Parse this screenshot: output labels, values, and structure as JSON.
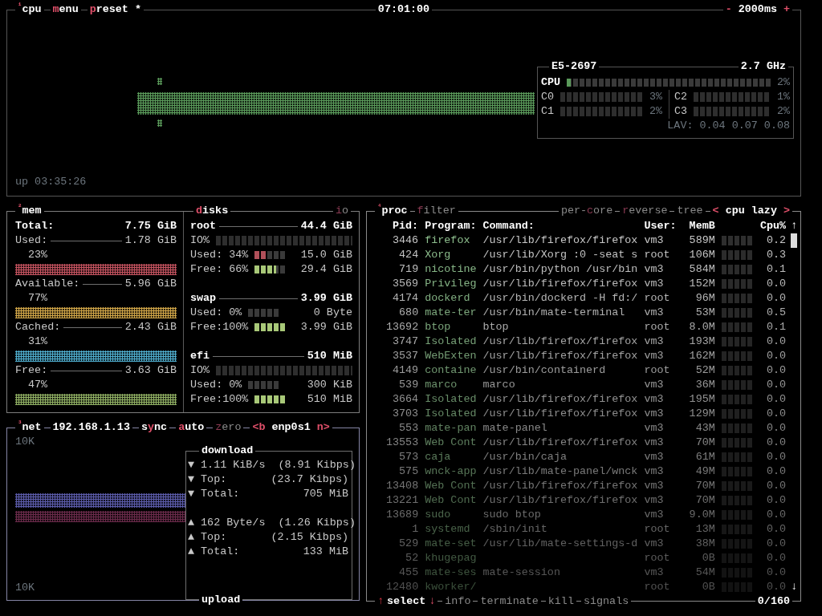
{
  "cpu": {
    "header": [
      {
        "index": "¹",
        "label": "cpu",
        "active": true
      },
      {
        "label": "**m**enu",
        "active": true
      },
      {
        "label": "**p**reset *",
        "active": true
      }
    ],
    "clock": "07:01:00",
    "interval": {
      "minus": "-",
      "value": "2000ms",
      "plus": "+"
    },
    "uptime": "up 03:35:26",
    "info": {
      "model": "E5-2697",
      "frequency": "2.7 GHz",
      "total": {
        "label": "CPU",
        "level": 0.02,
        "value": "2%"
      },
      "cores": [
        {
          "label": "C0",
          "value": "3%"
        },
        {
          "label": "C1",
          "value": "2%"
        },
        {
          "label": "C2",
          "value": "1%"
        },
        {
          "label": "C3",
          "value": "2%"
        }
      ],
      "load": "LAV: 0.04 0.07 0.08"
    }
  },
  "mem": {
    "header": {
      "index": "²",
      "label": "mem",
      "active": true
    },
    "total": {
      "label": "Total:",
      "value": "7.75 GiB"
    },
    "items": [
      {
        "label": "Used:",
        "value": "1.78 GiB",
        "percent": "23%",
        "color": "#c2525e"
      },
      {
        "label": "Available:",
        "value": "5.96 GiB",
        "percent": "77%",
        "color": "#cfa447"
      },
      {
        "label": "Cached:",
        "value": "2.43 GiB",
        "percent": "31%",
        "color": "#4eaccc"
      },
      {
        "label": "Free:",
        "value": "3.63 GiB",
        "percent": "47%",
        "color": "#8fae62"
      }
    ]
  },
  "disks": {
    "header": {
      "label": "**d**isks",
      "active": true
    },
    "io_toggle": {
      "label": "**i**o",
      "active": false
    },
    "items": [
      {
        "name": "root",
        "size": "44.4 GiB",
        "io_label": "IO%",
        "used": {
          "label": "Used: 34%",
          "level": 0.34,
          "value": "15.0 GiB"
        },
        "free": {
          "label": "Free: 66%",
          "level": 0.66,
          "value": "29.4 GiB"
        }
      },
      {
        "name": "swap",
        "size": "3.99 GiB",
        "used": {
          "label": "Used:  0%",
          "value": "0 Byte"
        },
        "free": {
          "label": "Free:100%",
          "level": 1,
          "value": "3.99 GiB"
        }
      },
      {
        "name": "efi",
        "size": "510 MiB",
        "io_label": "IO%",
        "used": {
          "label": "Used:  0%",
          "value": "300 KiB"
        },
        "free": {
          "label": "Free:100%",
          "level": 1,
          "value": "510 MiB"
        }
      }
    ]
  },
  "net": {
    "header": [
      {
        "index": "³",
        "label": "net",
        "active": true
      },
      {
        "label": "192.168.1.13",
        "active": true
      },
      {
        "label": "s**y**nc",
        "active": true
      },
      {
        "label": "**a**uto",
        "active": true
      },
      {
        "label": "**z**ero",
        "active": false
      }
    ],
    "interface": {
      "prev": "<b",
      "name": "enp0s1",
      "next": "n>"
    },
    "scale_top": "10K",
    "scale_bottom": "10K",
    "download": {
      "title": "download",
      "arrow": "▼",
      "lines": [
        {
          "label": "1.11 KiB/s",
          "value": "(8.91 Kibps)"
        },
        {
          "label": "Top:",
          "value": "(23.7 Kibps)"
        },
        {
          "label": "Total:",
          "value": "705 MiB"
        }
      ]
    },
    "upload": {
      "title": "upload",
      "arrow": "▲",
      "lines": [
        {
          "label": "162 Byte/s",
          "value": "(1.26 Kibps)"
        },
        {
          "label": "Top:",
          "value": "(2.15 Kibps)"
        },
        {
          "label": "Total:",
          "value": "133 MiB"
        }
      ]
    }
  },
  "proc": {
    "header": [
      {
        "index": "⁴",
        "label": "proc",
        "active": true
      },
      {
        "label": "**f**ilter",
        "active": false
      }
    ],
    "options": [
      {
        "label": "per-**c**ore",
        "active": false
      },
      {
        "label": "**r**everse",
        "active": false
      },
      {
        "label": "tree",
        "active": false
      }
    ],
    "sort": {
      "prev": "<",
      "value": "cpu lazy",
      "next": ">"
    },
    "columns": [
      "Pid:",
      "Program:",
      "Command:",
      "User:",
      "MemB",
      "Cpu%"
    ],
    "rows": [
      {
        "pid": "3446",
        "program": "firefox",
        "command": "/usr/lib/firefox/firefox",
        "user": "vm3",
        "mem": "589M",
        "cpu": "0.2"
      },
      {
        "pid": "424",
        "program": "Xorg",
        "command": "/usr/lib/Xorg :0 -seat s",
        "user": "root",
        "mem": "106M",
        "cpu": "0.3"
      },
      {
        "pid": "719",
        "program": "nicotine",
        "command": "/usr/bin/python /usr/bin",
        "user": "vm3",
        "mem": "584M",
        "cpu": "0.1"
      },
      {
        "pid": "3569",
        "program": "Privileg",
        "command": "/usr/lib/firefox/firefox",
        "user": "vm3",
        "mem": "152M",
        "cpu": "0.0"
      },
      {
        "pid": "4174",
        "program": "dockerd",
        "command": "/usr/bin/dockerd -H fd:/",
        "user": "root",
        "mem": "96M",
        "cpu": "0.0"
      },
      {
        "pid": "680",
        "program": "mate-ter",
        "command": "/usr/bin/mate-terminal",
        "user": "vm3",
        "mem": "53M",
        "cpu": "0.5"
      },
      {
        "pid": "13692",
        "program": "btop",
        "command": "btop",
        "user": "root",
        "mem": "8.0M",
        "cpu": "0.1"
      },
      {
        "pid": "3747",
        "program": "Isolated",
        "command": "/usr/lib/firefox/firefox",
        "user": "vm3",
        "mem": "193M",
        "cpu": "0.0"
      },
      {
        "pid": "3537",
        "program": "WebExten",
        "command": "/usr/lib/firefox/firefox",
        "user": "vm3",
        "mem": "162M",
        "cpu": "0.0"
      },
      {
        "pid": "4149",
        "program": "containe",
        "command": "/usr/bin/containerd",
        "user": "root",
        "mem": "52M",
        "cpu": "0.0"
      },
      {
        "pid": "539",
        "program": "marco",
        "command": "marco",
        "user": "vm3",
        "mem": "36M",
        "cpu": "0.0"
      },
      {
        "pid": "3664",
        "program": "Isolated",
        "command": "/usr/lib/firefox/firefox",
        "user": "vm3",
        "mem": "195M",
        "cpu": "0.0"
      },
      {
        "pid": "3703",
        "program": "Isolated",
        "command": "/usr/lib/firefox/firefox",
        "user": "vm3",
        "mem": "129M",
        "cpu": "0.0"
      },
      {
        "pid": "553",
        "program": "mate-pan",
        "command": "mate-panel",
        "user": "vm3",
        "mem": "43M",
        "cpu": "0.0"
      },
      {
        "pid": "13553",
        "program": "Web Cont",
        "command": "/usr/lib/firefox/firefox",
        "user": "vm3",
        "mem": "70M",
        "cpu": "0.0"
      },
      {
        "pid": "573",
        "program": "caja",
        "command": "/usr/bin/caja",
        "user": "vm3",
        "mem": "61M",
        "cpu": "0.0"
      },
      {
        "pid": "575",
        "program": "wnck-app",
        "command": "/usr/lib/mate-panel/wnck",
        "user": "vm3",
        "mem": "49M",
        "cpu": "0.0"
      },
      {
        "pid": "13408",
        "program": "Web Cont",
        "command": "/usr/lib/firefox/firefox",
        "user": "vm3",
        "mem": "70M",
        "cpu": "0.0"
      },
      {
        "pid": "13221",
        "program": "Web Cont",
        "command": "/usr/lib/firefox/firefox",
        "user": "vm3",
        "mem": "70M",
        "cpu": "0.0"
      },
      {
        "pid": "13689",
        "program": "sudo",
        "command": "sudo btop",
        "user": "vm3",
        "mem": "9.0M",
        "cpu": "0.0"
      },
      {
        "pid": "1",
        "program": "systemd",
        "command": "/sbin/init",
        "user": "root",
        "mem": "13M",
        "cpu": "0.0"
      },
      {
        "pid": "529",
        "program": "mate-set",
        "command": "/usr/lib/mate-settings-d",
        "user": "vm3",
        "mem": "38M",
        "cpu": "0.0"
      },
      {
        "pid": "52",
        "program": "khugepag",
        "user": "root",
        "mem": "0B",
        "cpu": "0.0"
      },
      {
        "pid": "455",
        "program": "mate-ses",
        "command": "mate-session",
        "user": "vm3",
        "mem": "54M",
        "cpu": "0.0"
      },
      {
        "pid": "12480",
        "program": "kworker/",
        "user": "root",
        "mem": "0B",
        "cpu": "0.0"
      }
    ],
    "scroll_up": "↑",
    "scroll_down": "↓",
    "footer": [
      {
        "prev": "↑",
        "label": "select",
        "next": "↓",
        "active": true
      },
      {
        "label": "info",
        "active": false
      },
      {
        "label": "terminate",
        "active": false
      },
      {
        "label": "kill",
        "active": false
      },
      {
        "label": "signals",
        "active": false
      }
    ],
    "count": "0/160"
  }
}
